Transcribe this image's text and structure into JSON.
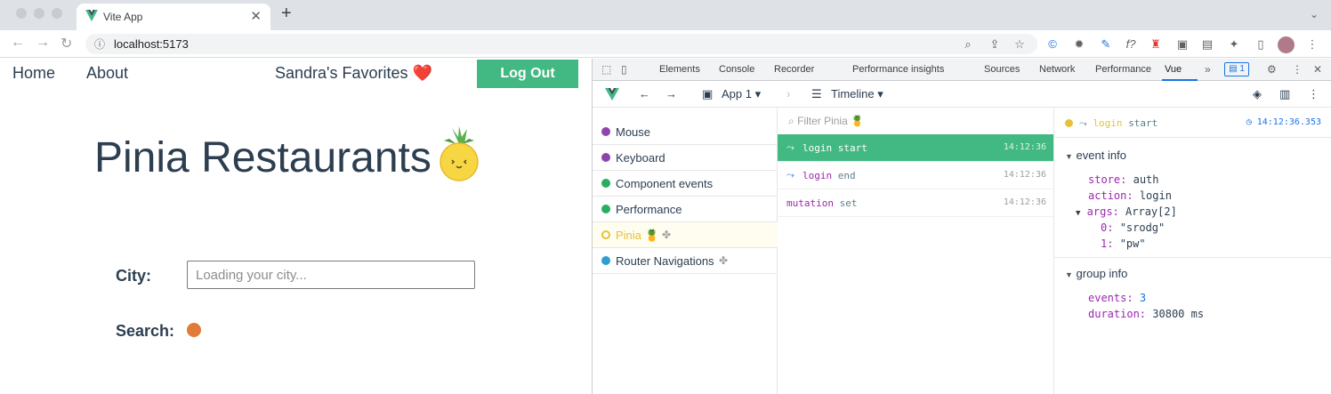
{
  "browser": {
    "tab_title": "Vite App",
    "url": "localhost:5173"
  },
  "app": {
    "nav": {
      "home": "Home",
      "about": "About"
    },
    "favorites_title": "Sandra's Favorites",
    "favorites_emoji": "❤️",
    "logout_label": "Log Out",
    "heading": "Pinia Restaurants",
    "city_label": "City:",
    "city_placeholder": "Loading your city...",
    "search_label": "Search:"
  },
  "devtools": {
    "tabs": [
      "Elements",
      "Console",
      "Recorder",
      "Performance insights",
      "Sources",
      "Network",
      "Performance",
      "Vue"
    ],
    "active_tab": "Vue",
    "issues_count": "1",
    "vue_bar": {
      "app_selector": "App 1",
      "view_selector": "Timeline"
    },
    "layers": [
      {
        "label": "Mouse",
        "color": "#8e44ad"
      },
      {
        "label": "Keyboard",
        "color": "#8e44ad"
      },
      {
        "label": "Component events",
        "color": "#27ae60"
      },
      {
        "label": "Performance",
        "color": "#27ae60"
      },
      {
        "label": "Pinia 🍍",
        "color": "#e6c13b"
      },
      {
        "label": "Router Navigations",
        "color": "#2e9ecf"
      }
    ],
    "filter_placeholder": "Filter Pinia 🍍",
    "events": [
      {
        "name": "login",
        "sub": "start",
        "time": "14:12:36"
      },
      {
        "name": "login",
        "sub": "end",
        "time": "14:12:36"
      },
      {
        "name": "mutation",
        "sub": "set",
        "time": "14:12:36"
      }
    ],
    "inspector": {
      "title_name": "login",
      "title_sub": "start",
      "timestamp": "14:12:36.353",
      "event_info_label": "event info",
      "store_key": "store:",
      "store_val": "auth",
      "action_key": "action:",
      "action_val": "login",
      "args_key": "args:",
      "args_val": "Array[2]",
      "arg0_key": "0:",
      "arg0_val": "\"srodg\"",
      "arg1_key": "1:",
      "arg1_val": "\"pw\"",
      "group_info_label": "group info",
      "events_key": "events:",
      "events_val": "3",
      "duration_key": "duration:",
      "duration_val": "30800 ms"
    }
  },
  "colors": {
    "vue_green": "#42b983",
    "text_dark": "#2c3e50",
    "pinia_purple": "#9c27b0",
    "devtools_blue": "#1a73e8"
  }
}
